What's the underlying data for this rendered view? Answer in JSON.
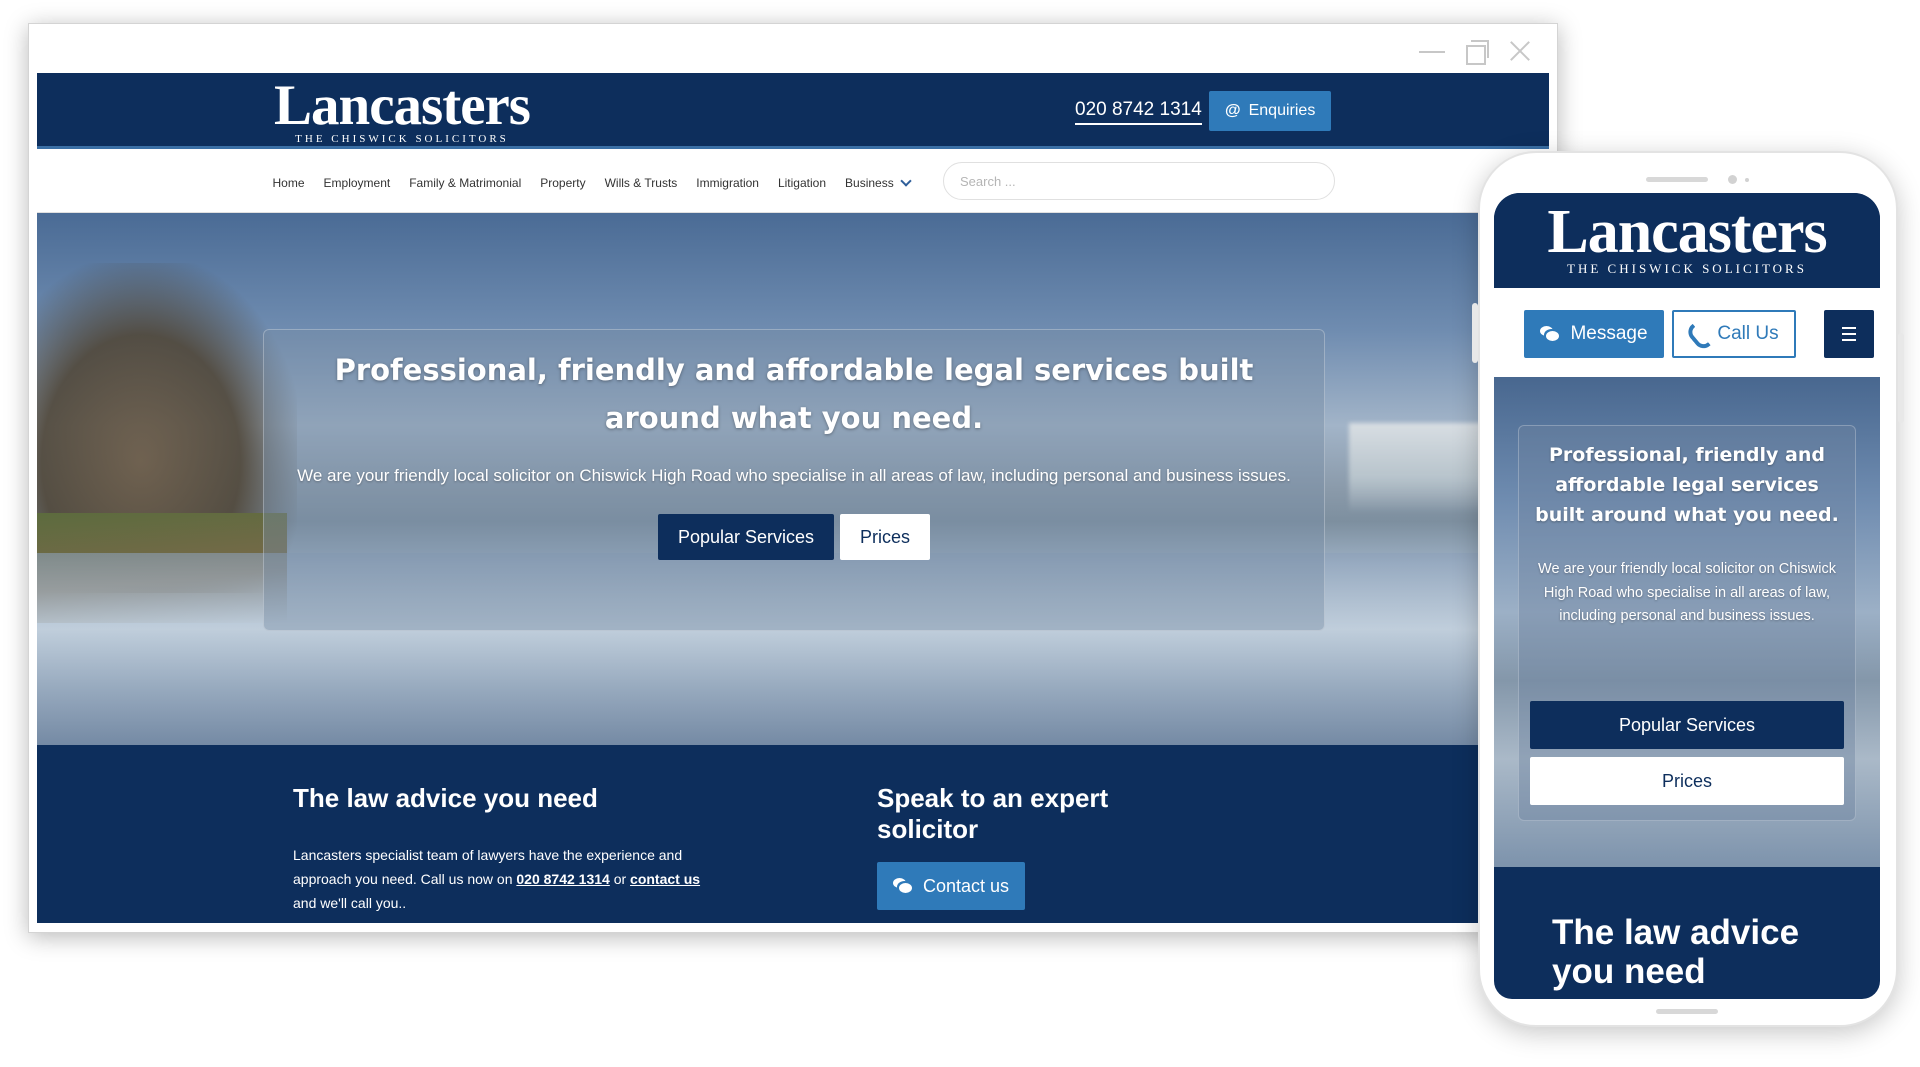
{
  "desktop": {
    "logo": {
      "main": "Lancasters",
      "sub": "THE CHISWICK SOLICITORS"
    },
    "header": {
      "phone": "020 8742 1314",
      "enquiries_label": "Enquiries",
      "enquiries_icon": "at-icon"
    },
    "nav": {
      "items": [
        "Home",
        "Employment",
        "Family & Matrimonial",
        "Property",
        "Wills & Trusts",
        "Immigration",
        "Litigation",
        "Business"
      ],
      "search_placeholder": "Search ..."
    },
    "hero": {
      "title": "Professional, friendly and affordable legal services built around what you need.",
      "text": "We are your friendly local solicitor on Chiswick High Road who specialise in all areas of law, including personal and business issues.",
      "popular_label": "Popular Services",
      "prices_label": "Prices"
    },
    "advice": {
      "title": "The law advice you need",
      "text_before": "Lancasters specialist team of lawyers have the experience and approach you need. Call us now on ",
      "phone_link": "020 8742 1314",
      "text_middle": " or ",
      "contact_link": "contact us",
      "text_after": " and we'll call you.."
    },
    "speak": {
      "title": "Speak to an expert solicitor",
      "contact_label": "Contact us"
    }
  },
  "mobile": {
    "logo": {
      "main": "Lancasters",
      "sub": "THE CHISWICK SOLICITORS"
    },
    "toolbar": {
      "message_label": "Message",
      "call_label": "Call Us"
    },
    "hero": {
      "title": "Professional, friendly and affordable legal services built around what you need.",
      "text": "We are your friendly local solicitor on Chiswick High Road who specialise in all areas of law, including personal and business issues.",
      "popular_label": "Popular Services",
      "prices_label": "Prices"
    },
    "advice_title": "The law advice you need"
  },
  "colors": {
    "navy": "#0d2e5c",
    "accent_blue": "#2f7ab9",
    "white": "#ffffff"
  }
}
